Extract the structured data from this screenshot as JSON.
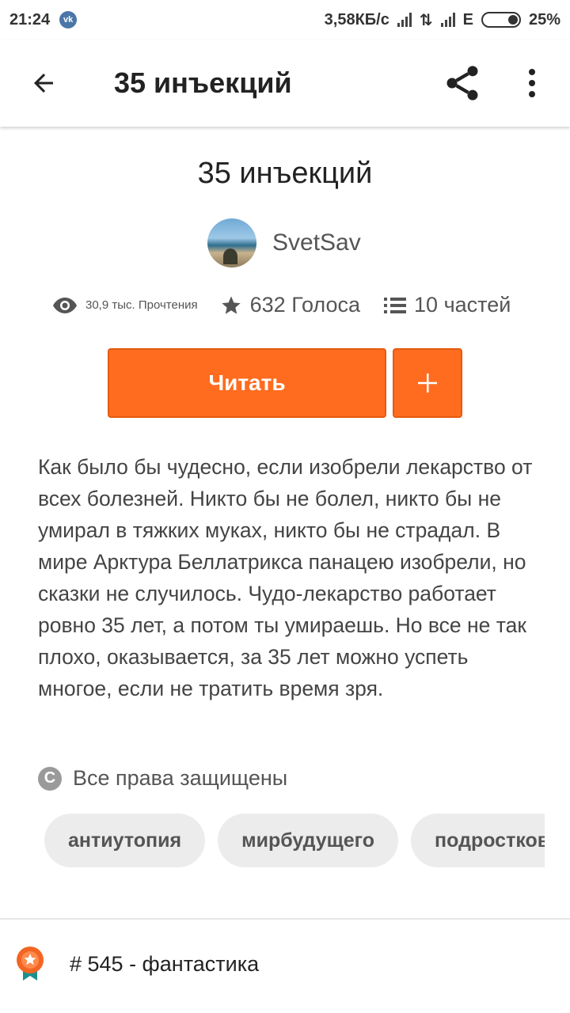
{
  "status": {
    "time": "21:24",
    "network_speed": "3,58КБ/с",
    "network_type": "E",
    "battery": "25%"
  },
  "toolbar": {
    "title": "35 инъекций"
  },
  "story": {
    "title": "35 инъекций",
    "author": "SvetSav",
    "reads": "30,9 тыс. Прочтения",
    "votes": "632 Голоса",
    "parts": "10 частей",
    "read_label": "Читать",
    "add_label": "+",
    "description": "Как было бы чудесно, если изобрели лекарство от всех болезней. Никто бы не болел, никто бы не умирал в тяжких муках, никто бы не страдал. В мире Арктура Беллатрикса панацею изобрели, но сказки не случилось.  Чудо-лекарство работает ровно 35 лет, а потом ты умираешь. Но все не так плохо, оказывается, за 35 лет можно успеть многое, если не тратить время зря.",
    "copyright": "Все права защищены",
    "tags": [
      "антиутопия",
      "мирбудущего",
      "подростковая"
    ],
    "ranking": "# 545 - фантастика"
  },
  "colors": {
    "accent": "#ff6c1f",
    "tag_bg": "#ececec",
    "rank_badge": "#f26522"
  }
}
